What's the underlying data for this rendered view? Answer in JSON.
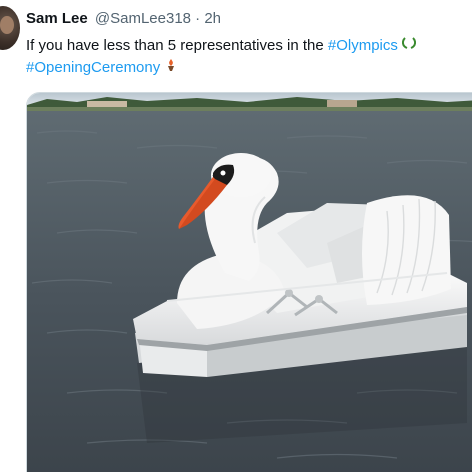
{
  "tweet": {
    "author_name": "Sam Lee",
    "handle": "@SamLee318",
    "separator": "·",
    "time": "2h",
    "text_part1": "If you have less than 5 representatives in the ",
    "hashtag1": "#Olympics",
    "emoji1": "🏛",
    "hashtag2": "#OpeningCeremony",
    "emoji2": "🔥",
    "media_description_icon": "swan-pedal-boat-image"
  },
  "colors": {
    "text": "#0f1419",
    "secondary": "#536471",
    "link": "#1d9bf0",
    "water": "#48505a",
    "swan": "#f4f4f4",
    "beak": "#e85a2c"
  }
}
